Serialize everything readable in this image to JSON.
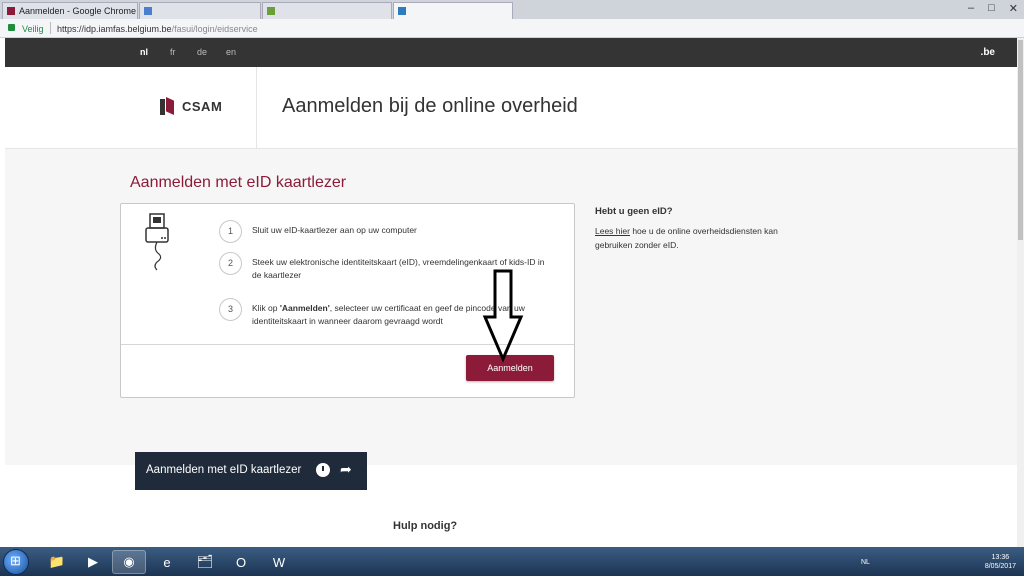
{
  "browser": {
    "tabs": [
      {
        "label": "Aanmelden - Google Chrome",
        "active": false
      },
      {
        "label": "",
        "active": false
      },
      {
        "label": "",
        "active": false
      },
      {
        "label": "",
        "active": true
      }
    ],
    "secure_label": "Veilig",
    "url_base": "https://idp.iamfas.belgium.be",
    "url_path": "/fasui/login/eidservice"
  },
  "lang_bar": {
    "languages": [
      "nl",
      "fr",
      "de",
      "en"
    ],
    "active": "nl",
    "domain": ".be"
  },
  "header": {
    "logo_text": "CSAM",
    "title": "Aanmelden bij de online overheid"
  },
  "main": {
    "section_title": "Aanmelden met eID kaartlezer",
    "steps": [
      {
        "num": "1",
        "text_before": "Sluit uw eID-kaartlezer aan op uw computer",
        "bold": "",
        "text_after": ""
      },
      {
        "num": "2",
        "text_before": "Steek uw elektronische identiteitskaart (eID), vreemdelingenkaart of kids-ID in de kaartlezer",
        "bold": "",
        "text_after": ""
      },
      {
        "num": "3",
        "text_before": "Klik op ",
        "bold": "'Aanmelden'",
        "text_after": ", selecteer uw certificaat en geef de pincode van uw identiteitskaart in wanneer daarom gevraagd wordt"
      }
    ],
    "login_button": "Aanmelden"
  },
  "sidebar": {
    "title": "Hebt u geen eID?",
    "link": "Lees hier",
    "text": " hoe u de online overheidsdiensten kan gebruiken zonder eID."
  },
  "lower": {
    "help_title": "Hulp nodig?",
    "video_title": "Aanmelden met eID kaartlezer"
  },
  "taskbar": {
    "lang": "NL",
    "time": "13:36",
    "date": "8/05/2017"
  },
  "colors": {
    "accent": "#8c1b3a",
    "header_dark": "#343434"
  }
}
